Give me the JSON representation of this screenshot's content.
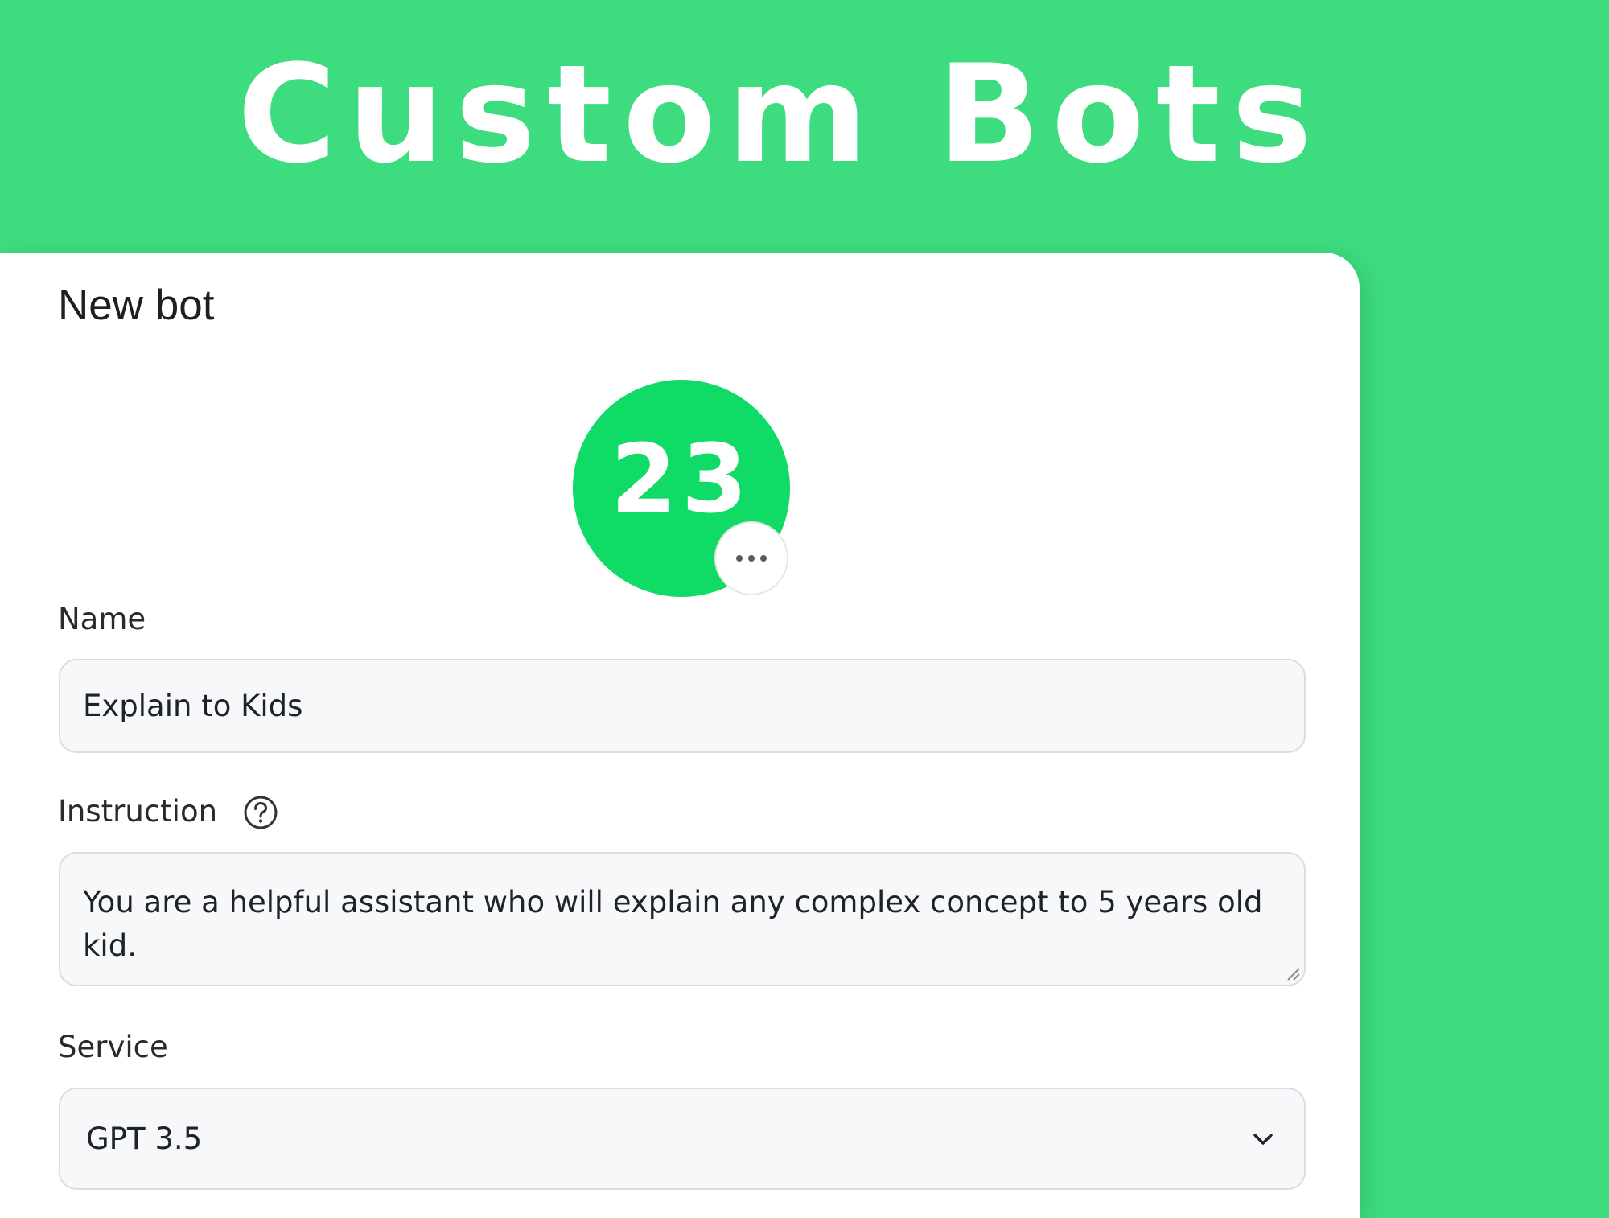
{
  "hero": {
    "title": "Custom Bots"
  },
  "card": {
    "title": "New bot"
  },
  "avatar": {
    "text": "23",
    "more_icon": "more-horizontal-icon"
  },
  "form": {
    "name": {
      "label": "Name",
      "value": "Explain to Kids"
    },
    "instruction": {
      "label": "Instruction",
      "help_icon": "question-circle-icon",
      "value": "You are a helpful assistant who will explain any complex concept to 5 years old kid."
    },
    "service": {
      "label": "Service",
      "value": "GPT 3.5",
      "dropdown_icon": "chevron-down-icon"
    }
  },
  "colors": {
    "background": "#3ddc7f",
    "avatar": "#0fdb66",
    "card": "#ffffff",
    "field_background": "#f7f8fa",
    "field_border": "#d9dce1"
  }
}
